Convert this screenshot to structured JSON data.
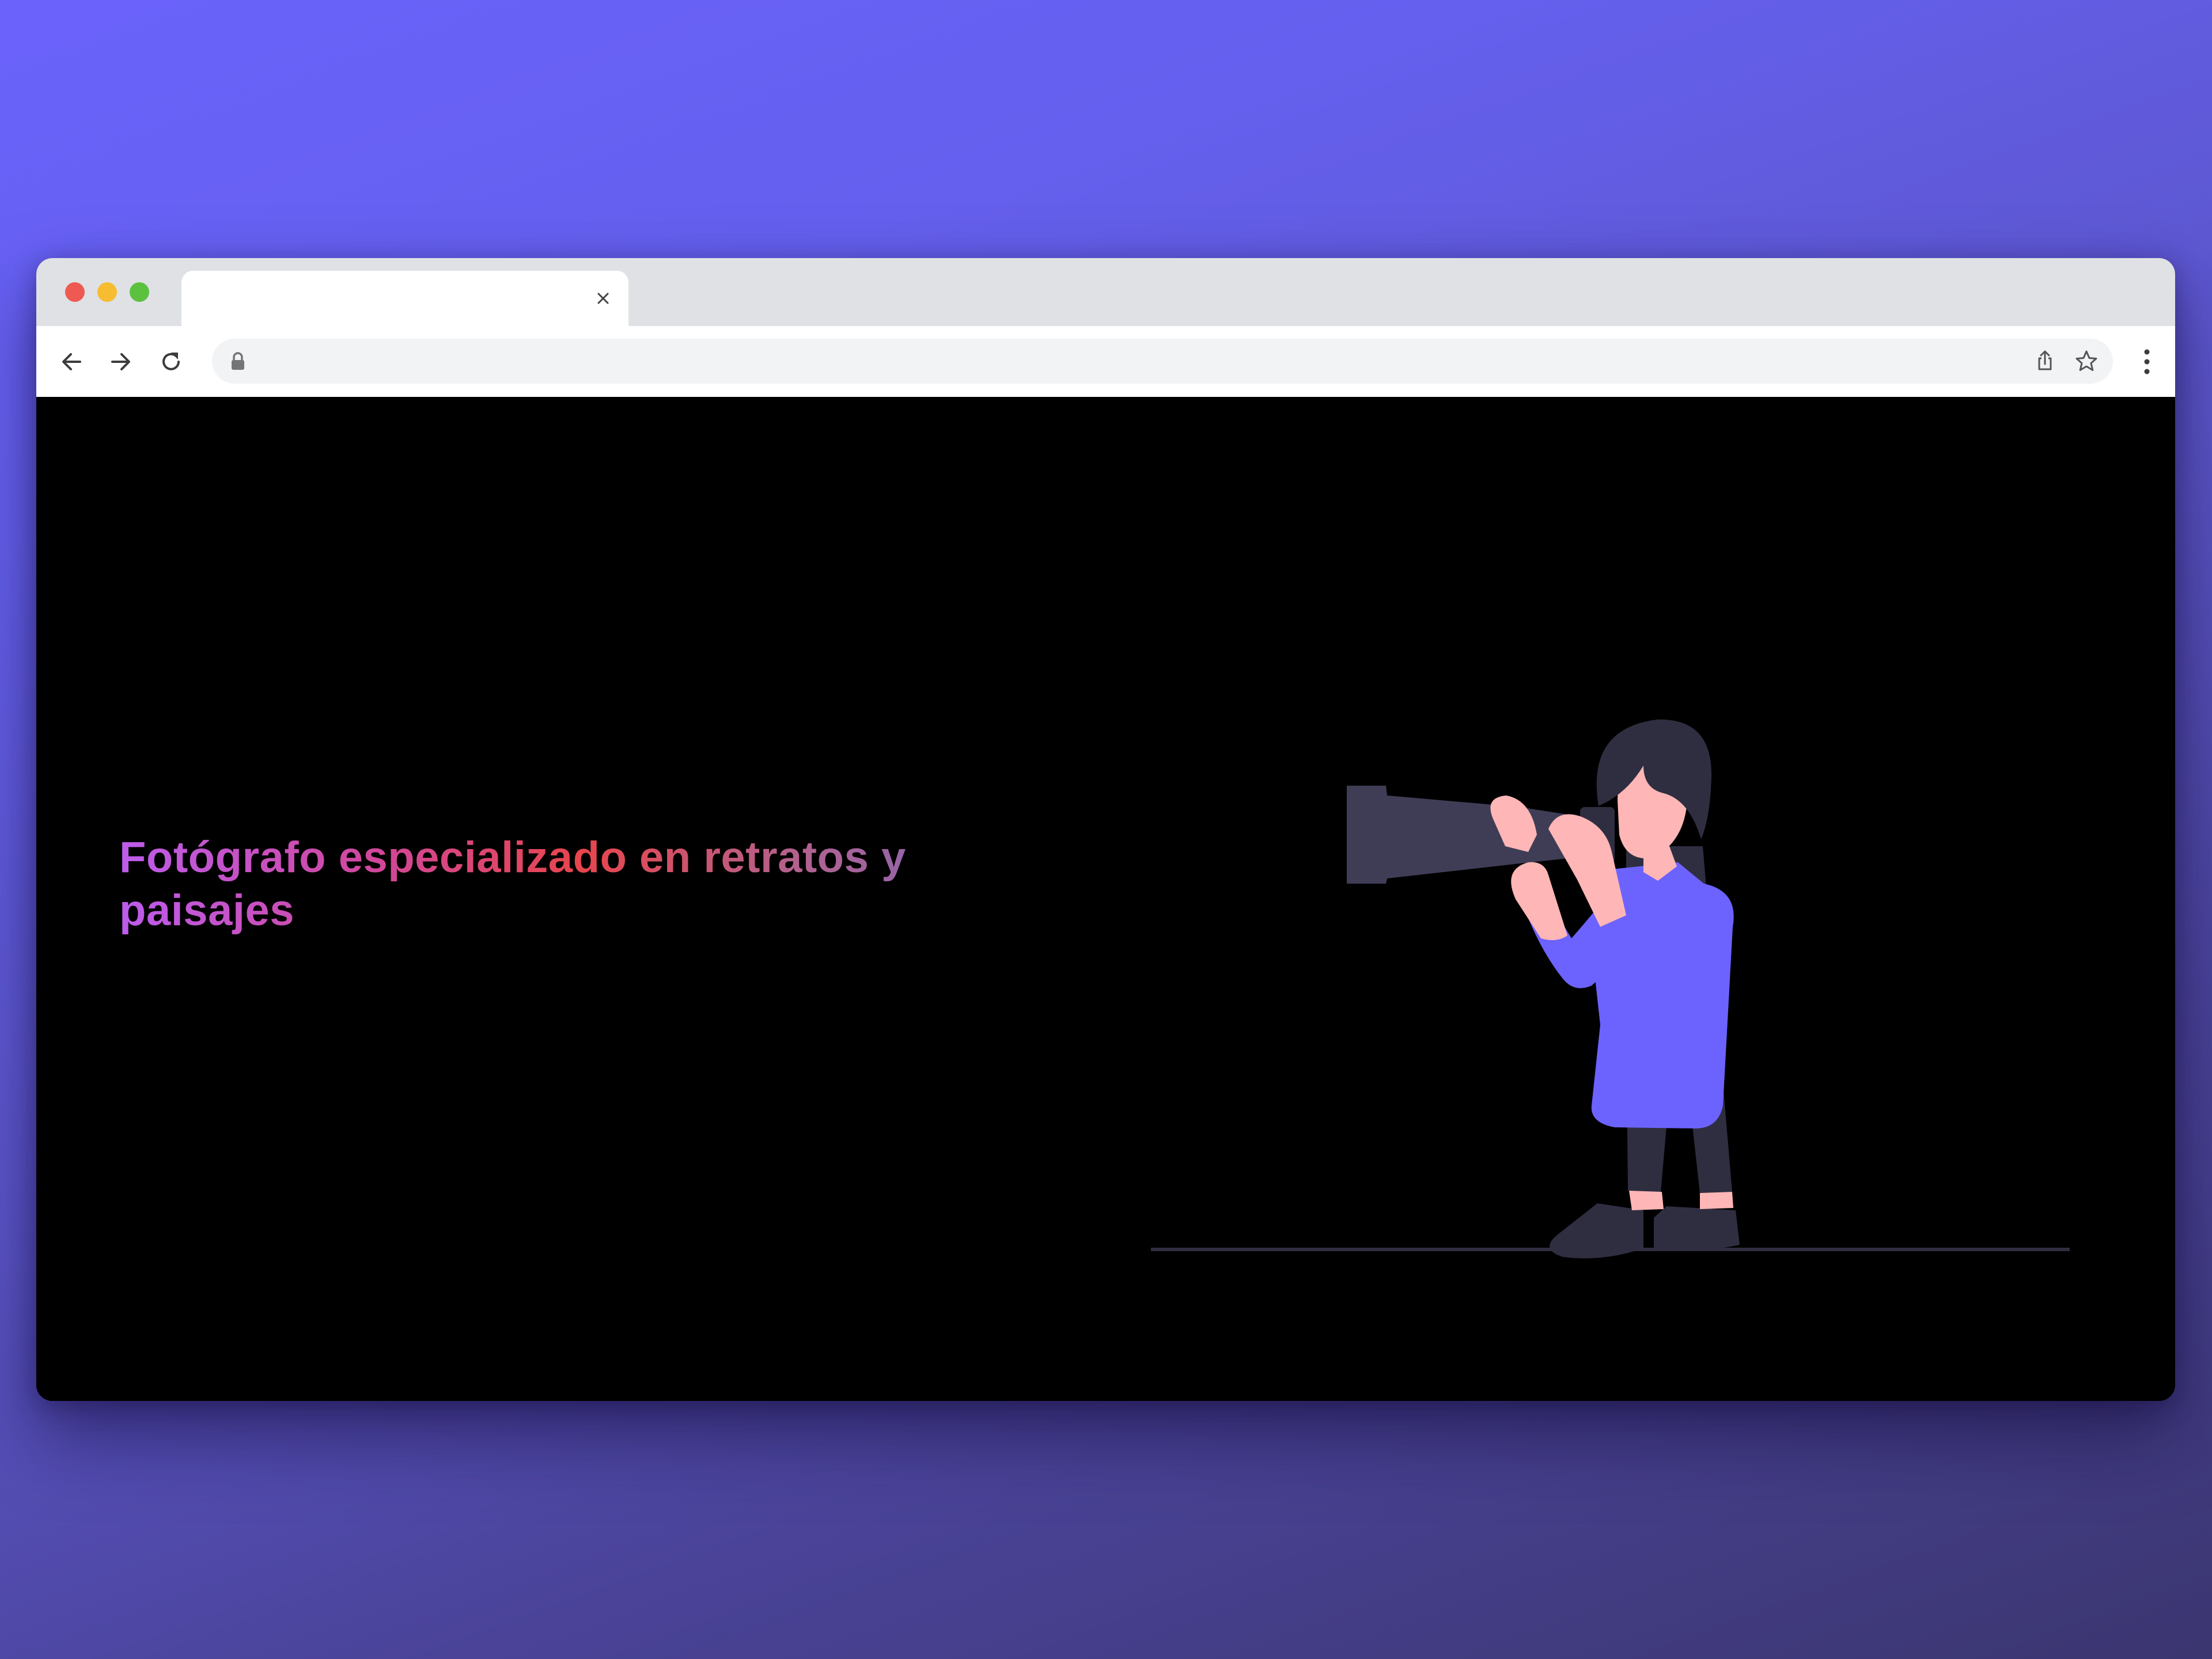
{
  "browser": {
    "tab": {
      "title": ""
    },
    "address_bar": {
      "url": ""
    }
  },
  "colors": {
    "background_top": "#6a62fb",
    "background_bottom": "#3b3670",
    "page_background": "#000000",
    "headline_gradient": [
      "#bd5cec",
      "#e8454c",
      "#7566c4"
    ],
    "shirt": "#6c63ff",
    "pants": "#2f2e41",
    "skin": "#ffb6b6"
  },
  "hero": {
    "headline": "Fotógrafo especializado en retratos y paisajes"
  },
  "icons": [
    "close-icon",
    "back-arrow-icon",
    "forward-arrow-icon",
    "reload-icon",
    "lock-icon",
    "share-icon",
    "star-icon",
    "more-vert-icon"
  ],
  "illustration": "photographer-with-telephoto-camera"
}
